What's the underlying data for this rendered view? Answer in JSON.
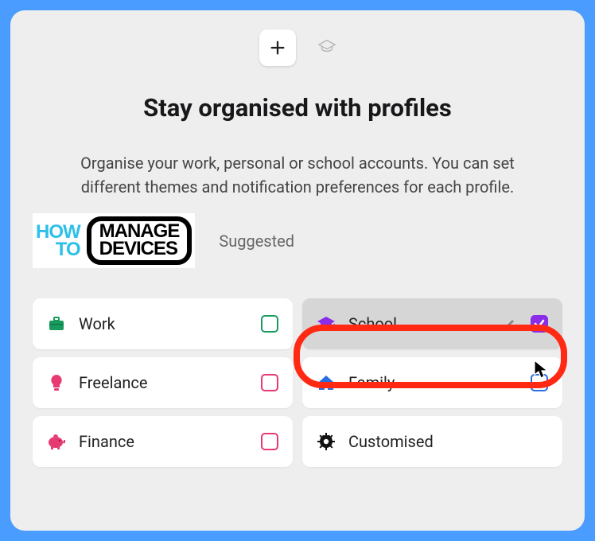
{
  "header": {
    "title": "Stay organised with profiles",
    "subtitle": "Organise your work, personal or school accounts. You can set different themes and notification preferences for each profile."
  },
  "logo": {
    "left_top": "HOW",
    "left_bottom": "TO",
    "right_top": "MANAGE",
    "right_bottom": "DEVICES"
  },
  "section_label": "Suggested",
  "tiles": {
    "work": {
      "label": "Work",
      "checked": false,
      "color": "green"
    },
    "school": {
      "label": "School",
      "checked": true,
      "color": "purple",
      "selected": true
    },
    "freelance": {
      "label": "Freelance",
      "checked": false,
      "color": "pink"
    },
    "family": {
      "label": "Family",
      "checked": false,
      "color": "blue"
    },
    "finance": {
      "label": "Finance",
      "checked": false,
      "color": "pink"
    },
    "customised": {
      "label": "Customised"
    }
  },
  "icons": {
    "plus": "plus-icon",
    "cap": "graduation-cap-icon",
    "briefcase": "briefcase-icon",
    "bulb": "lightbulb-icon",
    "piggy": "piggy-bank-icon",
    "house": "house-icon",
    "gear": "gear-icon",
    "pencil": "pencil-icon"
  },
  "colors": {
    "green": "#1a9b5e",
    "pink": "#e83a72",
    "blue": "#2a6fe0",
    "purple": "#8a2ce8",
    "red_highlight": "#ff2914"
  }
}
